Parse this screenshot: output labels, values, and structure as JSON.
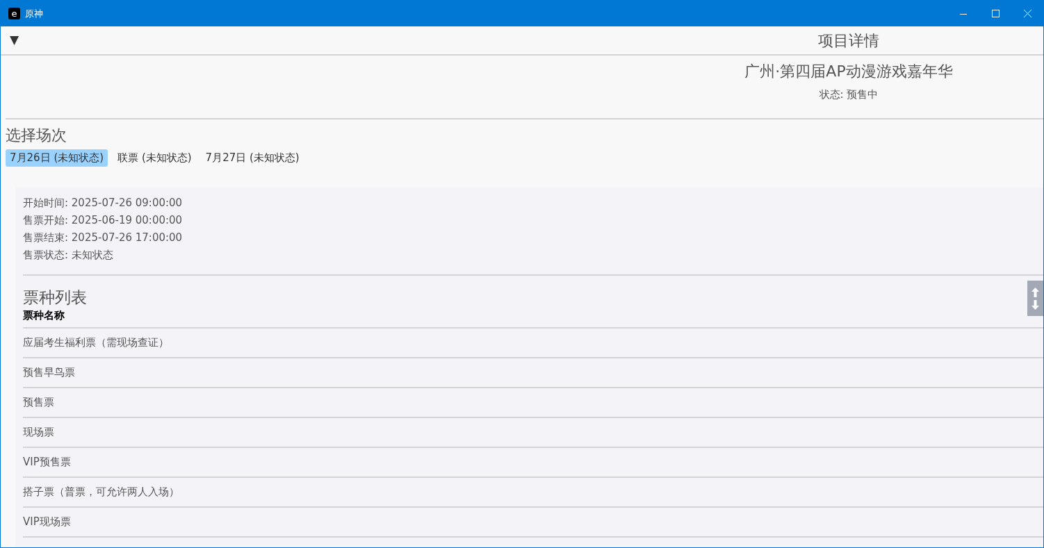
{
  "window": {
    "title": "原神",
    "app_icon_letter": "e"
  },
  "header": {
    "toggle": "▼",
    "title": "项目详情"
  },
  "project": {
    "name": "广州·第四届AP动漫游戏嘉年华",
    "status": "状态: 预售中"
  },
  "sessions": {
    "heading": "选择场次",
    "tabs": [
      {
        "label": "7月26日 (未知状态)",
        "selected": true
      },
      {
        "label": "联票 (未知状态)",
        "selected": false
      },
      {
        "label": "7月27日 (未知状态)",
        "selected": false
      }
    ]
  },
  "session_info": [
    "开始时间: 2025-07-26 09:00:00",
    "售票开始: 2025-06-19 00:00:00",
    "售票结束: 2025-07-26 17:00:00",
    "售票状态: 未知状态"
  ],
  "tickets": {
    "heading": "票种列表",
    "column": "票种名称",
    "rows": [
      "应届考生福利票（需现场查证）",
      "预售早鸟票",
      "预售票",
      "现场票",
      "VIP预售票",
      "搭子票（普票，可允许两人入场）",
      "VIP现场票"
    ]
  }
}
